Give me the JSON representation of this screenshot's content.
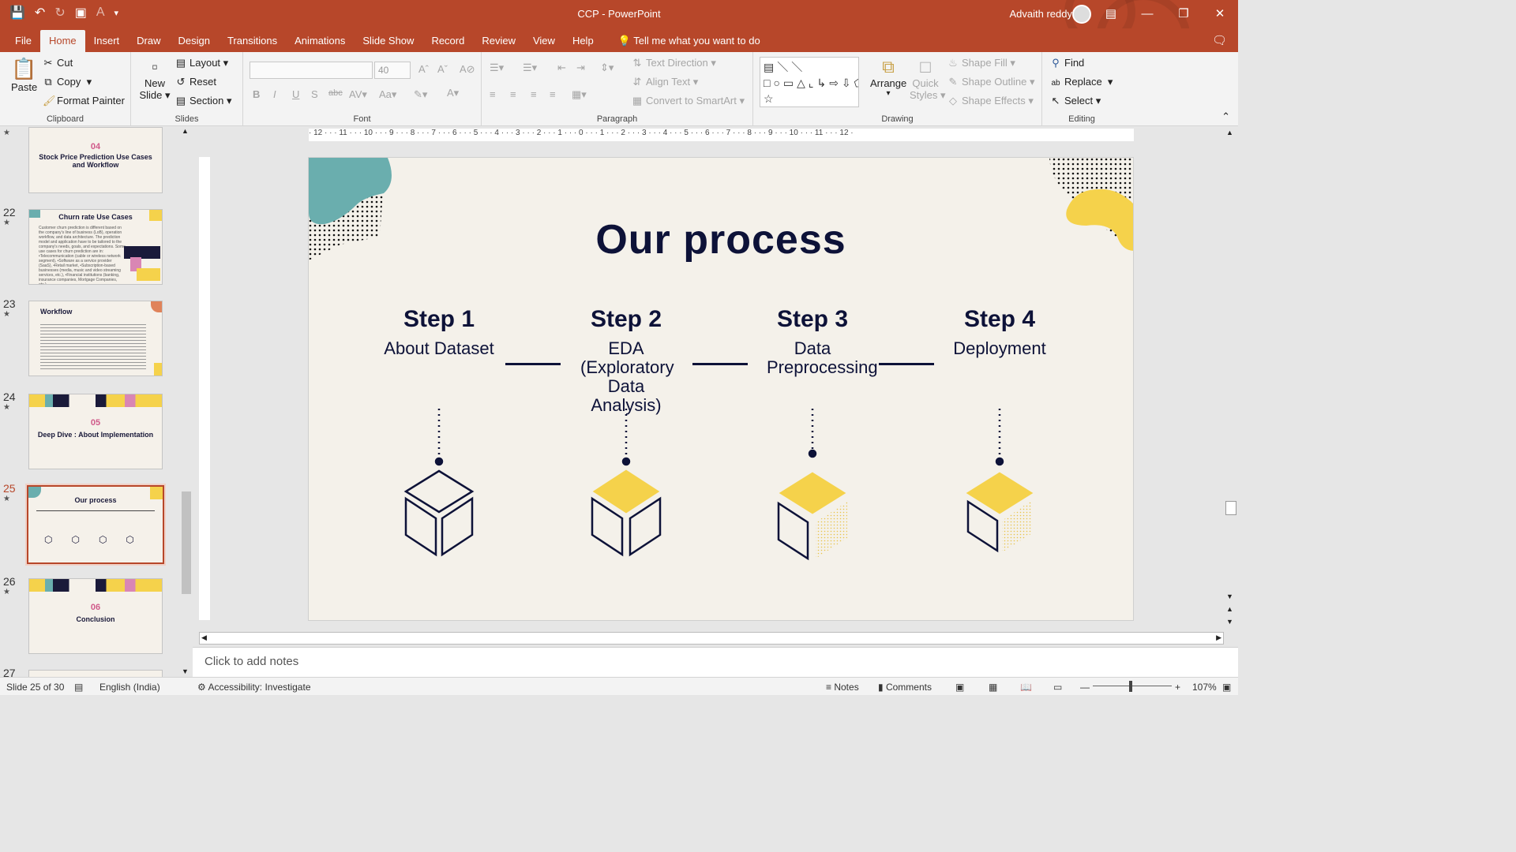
{
  "window": {
    "title": "CCP  -  PowerPoint",
    "user": "Advaith reddy"
  },
  "qat": {
    "save_icon": "save-icon",
    "undo_icon": "undo-icon",
    "redo_icon": "redo-icon"
  },
  "tabs": [
    "File",
    "Home",
    "Insert",
    "Draw",
    "Design",
    "Transitions",
    "Animations",
    "Slide Show",
    "Record",
    "Review",
    "View",
    "Help"
  ],
  "tell_me": "Tell me what you want to do",
  "ribbon": {
    "clipboard": {
      "paste": "Paste",
      "cut": "Cut",
      "copy": "Copy",
      "format_painter": "Format Painter",
      "label": "Clipboard"
    },
    "slides": {
      "new_slide_1": "New",
      "new_slide_2": "Slide",
      "layout": "Layout",
      "reset": "Reset",
      "section": "Section",
      "label": "Slides"
    },
    "font": {
      "size": "40",
      "label": "Font",
      "bold": "B",
      "italic": "I",
      "underline": "U",
      "shadow": "S",
      "strike": "abc"
    },
    "paragraph": {
      "text_direction": "Text Direction",
      "align_text": "Align Text",
      "convert_smartart": "Convert to SmartArt",
      "label": "Paragraph"
    },
    "drawing": {
      "arrange": "Arrange",
      "quick_styles_1": "Quick",
      "quick_styles_2": "Styles",
      "shape_fill": "Shape Fill",
      "shape_outline": "Shape Outline",
      "shape_effects": "Shape Effects",
      "label": "Drawing"
    },
    "editing": {
      "find": "Find",
      "replace": "Replace",
      "select": "Select",
      "label": "Editing"
    }
  },
  "thumbnails": [
    {
      "num": "",
      "sec_num": "04",
      "title": "Stock Price Prediction Use Cases and Workflow"
    },
    {
      "num": "22",
      "title": "Churn rate Use Cases",
      "body": "Customer churn prediction is different based on the company's line of business (LoB), operation workflow, and data architecture. The prediction model and application have to be tailored to the company's needs, goals, and expectations. Some use cases for churn prediction are in: •Telecommunication (cable or wireless network segment), •Software as a service provider (SaaS), •Retail market, •Subscription-based businesses (media, music and video streaming services, etc.), •Financial institutions (banking, insurance companies, Mortgage Companies, etc.)"
    },
    {
      "num": "23",
      "title": "Workflow"
    },
    {
      "num": "24",
      "sec_num": "05",
      "title": "Deep Dive : About Implementation"
    },
    {
      "num": "25",
      "title": "Our process"
    },
    {
      "num": "26",
      "sec_num": "06",
      "title": "Conclusion"
    },
    {
      "num": "27"
    }
  ],
  "ruler_h": "· 12 · · · 11 · · · 10 · · · 9 · · · 8 · · · 7 · · · 6 · · · 5 · · · 4 · · · 3 · · · 2 · · · 1 · · · 0 · · · 1 · · · 2 · · · 3 · · · 4 · · · 5 · · · 6 · · · 7 · · · 8 · · · 9 · · · 10 · · · 11 · · · 12 ·",
  "slide": {
    "title": "Our process",
    "steps": [
      {
        "head": "Step 1",
        "desc": "About Dataset"
      },
      {
        "head": "Step 2",
        "desc": "EDA (Exploratory Data Analysis)"
      },
      {
        "head": "Step 3",
        "desc": "Data Preprocessing"
      },
      {
        "head": "Step 4",
        "desc": "Deployment"
      }
    ],
    "colors": {
      "navy": "#0d1238",
      "yellow": "#f5d24b",
      "teal": "#6aaeae",
      "bg": "#f4f1ea"
    }
  },
  "notes_placeholder": "Click to add notes",
  "status": {
    "slide": "Slide 25 of 30",
    "language": "English (India)",
    "accessibility": "Accessibility: Investigate",
    "notes": "Notes",
    "comments": "Comments",
    "zoom": "107%"
  }
}
